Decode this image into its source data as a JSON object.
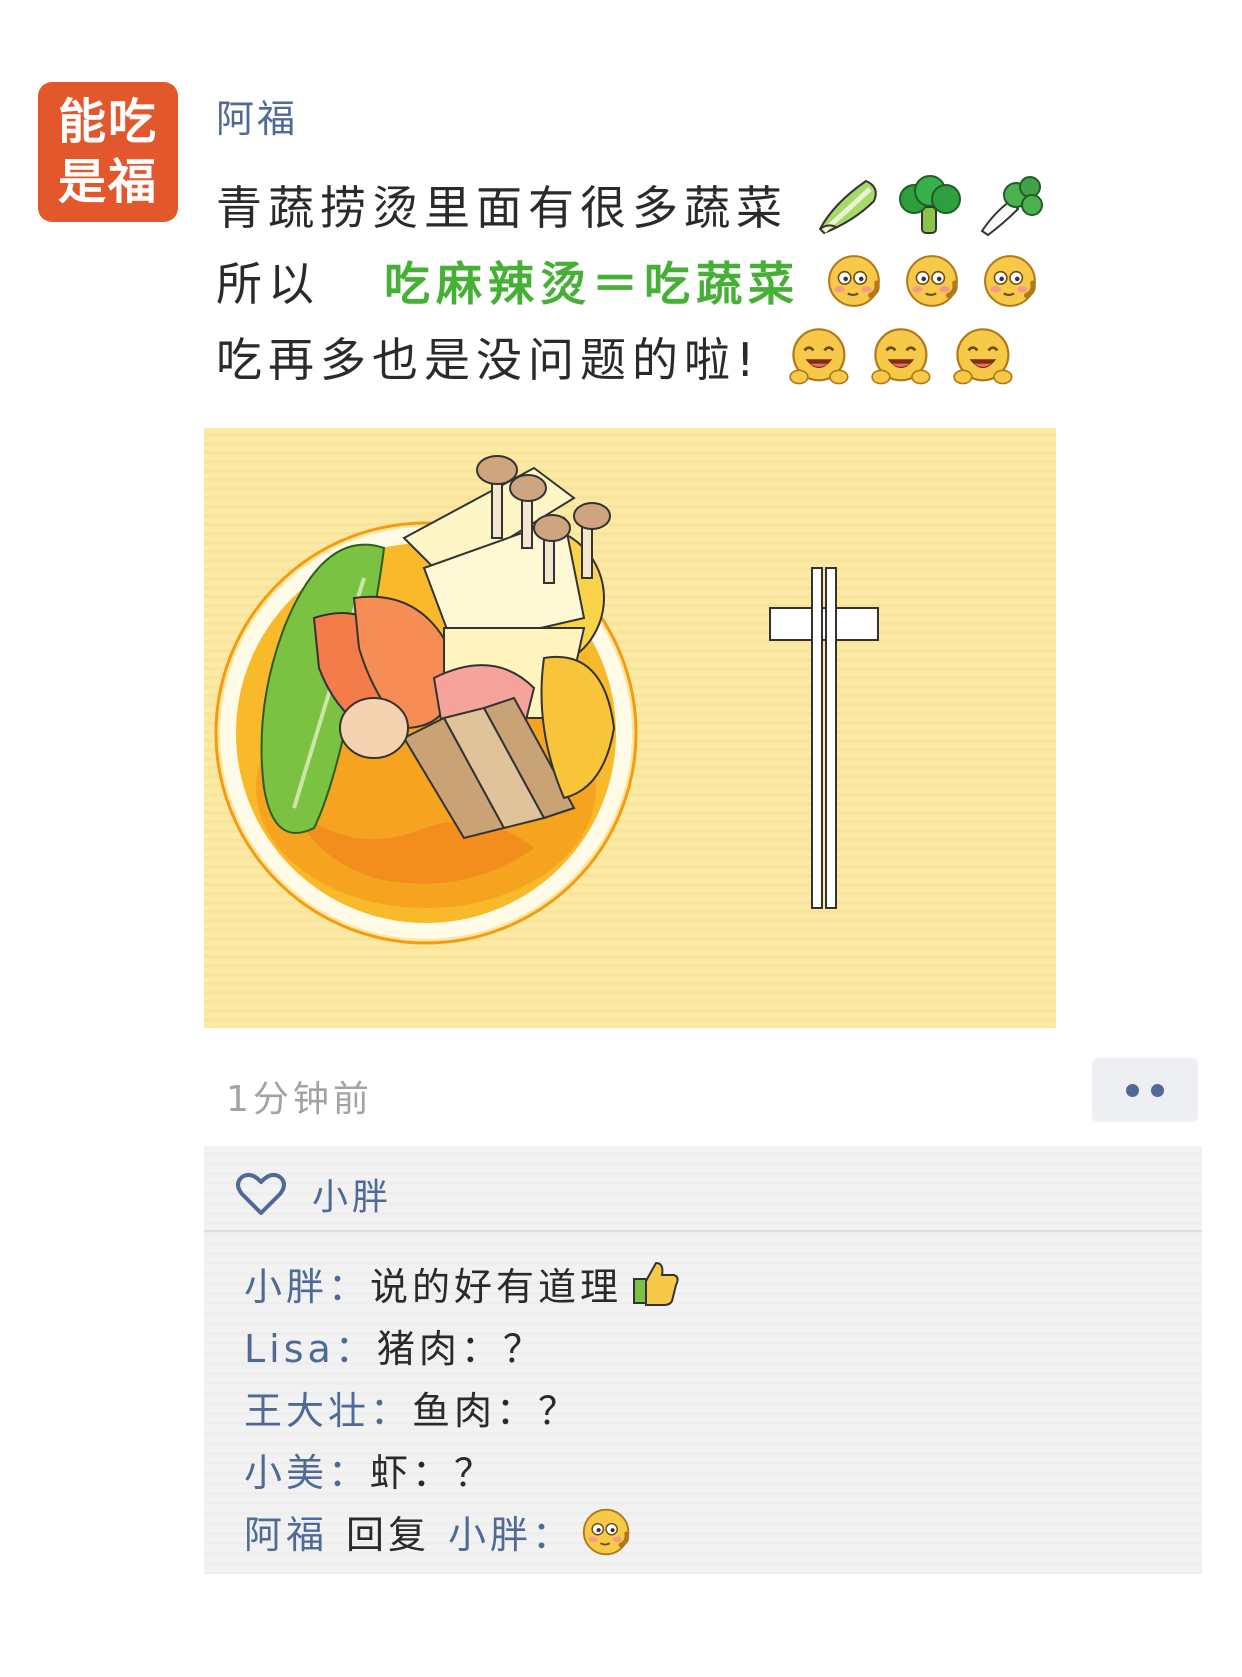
{
  "avatar": {
    "line1": "能吃",
    "line2": "是福"
  },
  "post": {
    "author": "阿福",
    "line1": "青蔬捞烫里面有很多蔬菜",
    "line2_prefix": "所以",
    "line2_highlight": "吃麻辣烫＝吃蔬菜",
    "line3": "吃再多也是没问题的啦!",
    "emojis_line1": [
      "cabbage-icon",
      "broccoli-icon",
      "bok-choy-icon"
    ],
    "emojis_line2": [
      "smirk-emoji-icon",
      "smirk-emoji-icon",
      "smirk-emoji-icon"
    ],
    "emojis_line3": [
      "laughing-emoji-icon",
      "laughing-emoji-icon",
      "laughing-emoji-icon"
    ]
  },
  "timestamp": "1分钟前",
  "likes": {
    "names": "小胖"
  },
  "comments": [
    {
      "name": "小胖：",
      "text": "说的好有道理"
    },
    {
      "name": "Lisa：",
      "text": "猪肉：？"
    },
    {
      "name": "王大壮：",
      "text": "鱼肉：？"
    },
    {
      "name": "小美：",
      "text": "虾：？"
    },
    {
      "name": "阿福",
      "reply_word": "回复",
      "reply_to": "小胖：",
      "text": ""
    }
  ],
  "colors": {
    "link_blue": "#4f6a96",
    "highlight_green": "#45b035",
    "avatar_orange": "#e2582c",
    "mat_yellow": "#fbe9a4",
    "comment_bg": "#f2f2f2"
  }
}
